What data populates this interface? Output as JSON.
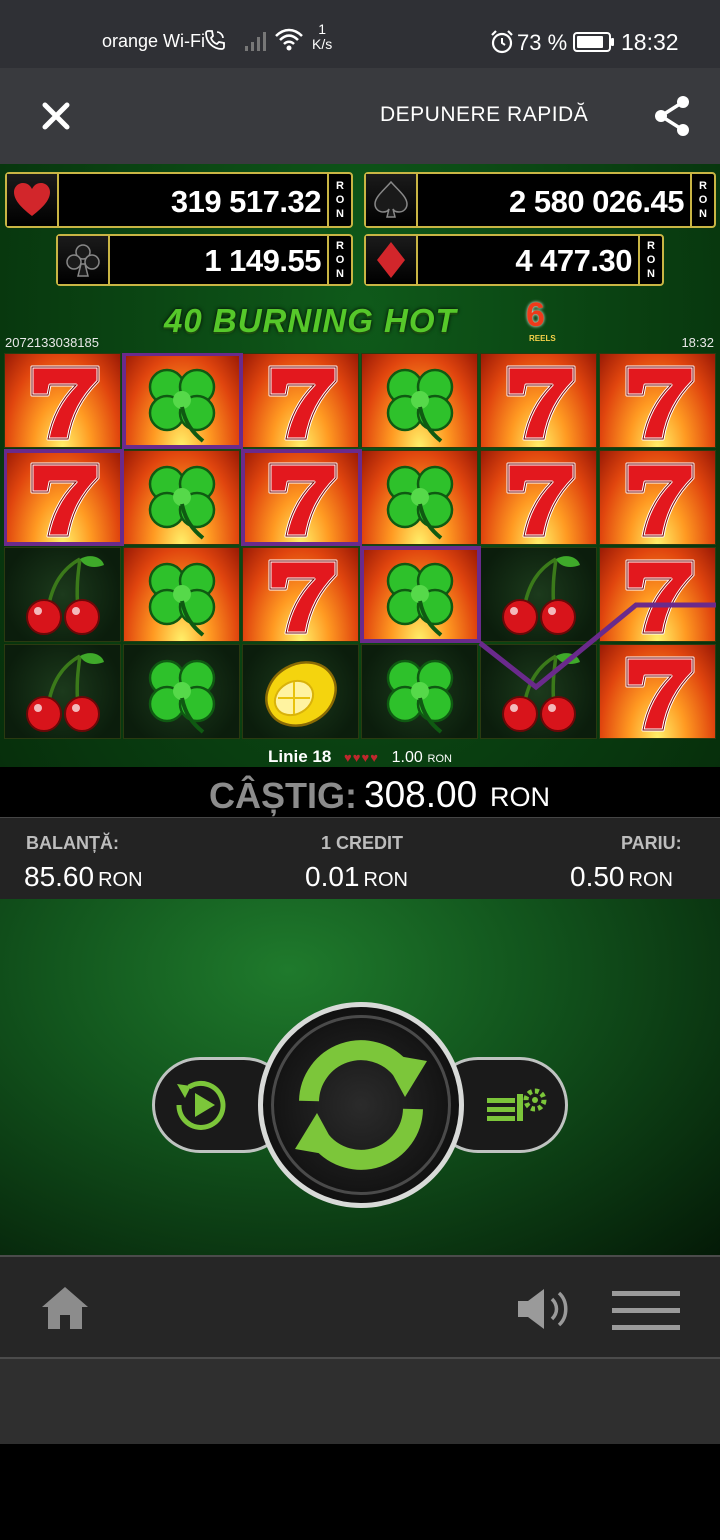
{
  "status_bar": {
    "carrier": "orange Wi-Fi",
    "speed_value": "1",
    "speed_unit": "K/s",
    "battery_percent": "73 %",
    "time": "18:32"
  },
  "app_bar": {
    "close_icon": "close-icon",
    "title": "DEPUNERE RAPIDĂ",
    "share_icon": "share-icon"
  },
  "jackpots": [
    {
      "suit": "heart",
      "value": "319 517.32",
      "currency": "RON"
    },
    {
      "suit": "spade",
      "value": "2 580 026.45",
      "currency": "RON"
    },
    {
      "suit": "club",
      "value": "1 149.55",
      "currency": "RON"
    },
    {
      "suit": "diamond",
      "value": "4 477.30",
      "currency": "RON"
    }
  ],
  "game": {
    "title": "40 BURNING HOT",
    "title_number": "6",
    "title_sub": "REELS",
    "round_id": "2072133038185",
    "clock": "18:32",
    "reels": [
      [
        "seven",
        "clover",
        "seven",
        "clover",
        "seven",
        "seven"
      ],
      [
        "seven",
        "clover",
        "seven",
        "clover",
        "seven",
        "seven"
      ],
      [
        "cherry",
        "clover",
        "seven",
        "clover",
        "cherry",
        "seven"
      ],
      [
        "cherry",
        "clover",
        "lemon",
        "clover",
        "cherry",
        "seven"
      ]
    ],
    "win_line_color": "#6a2a8c",
    "line_info": {
      "label": "Linie 18",
      "hearts": "♥♥♥♥",
      "bet": "1.00",
      "currency": "RON"
    },
    "win": {
      "label": "CÂȘTIG:",
      "value": "308.00",
      "currency": "RON"
    }
  },
  "stats": {
    "balance_label": "BALANȚĂ:",
    "balance_value": "85.60",
    "credit_label": "1 CREDIT",
    "credit_value": "0.01",
    "bet_label": "PARIU:",
    "bet_value": "0.50",
    "currency": "RON"
  },
  "controls": {
    "autoplay_icon": "autoplay-icon",
    "spin_icon": "spin-icon",
    "settings_icon": "bet-settings-icon",
    "accent": "#7cc63a"
  },
  "bottom_bar": {
    "home_icon": "home-icon",
    "sound_icon": "speaker-icon",
    "menu_icon": "menu-icon"
  }
}
